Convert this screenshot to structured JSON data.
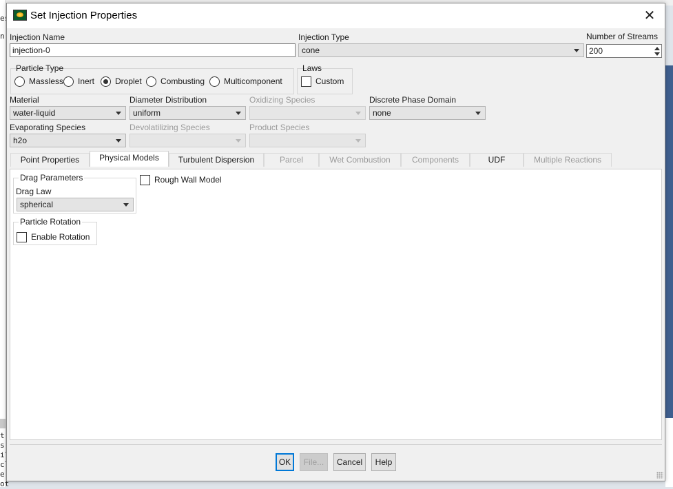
{
  "background": {
    "left_lines": [
      "es",
      "n",
      "t",
      "s",
      "il",
      "cl",
      "e",
      "ot"
    ]
  },
  "dialog": {
    "title": "Set Injection Properties",
    "close_glyph": "✕"
  },
  "injection_name": {
    "label": "Injection Name",
    "value": "injection-0"
  },
  "injection_type": {
    "label": "Injection Type",
    "value": "cone"
  },
  "number_of_streams": {
    "label": "Number of Streams",
    "value": "200"
  },
  "particle_type": {
    "label": "Particle Type",
    "options": [
      "Massless",
      "Inert",
      "Droplet",
      "Combusting",
      "Multicomponent"
    ],
    "selected": "Droplet"
  },
  "laws": {
    "label": "Laws",
    "custom_label": "Custom",
    "custom_checked": false
  },
  "material": {
    "label": "Material",
    "value": "water-liquid"
  },
  "diameter_distribution": {
    "label": "Diameter Distribution",
    "value": "uniform"
  },
  "oxidizing_species": {
    "label": "Oxidizing Species",
    "value": ""
  },
  "discrete_phase_domain": {
    "label": "Discrete Phase Domain",
    "value": "none"
  },
  "evaporating_species": {
    "label": "Evaporating Species",
    "value": "h2o"
  },
  "devolatilizing_species": {
    "label": "Devolatilizing Species",
    "value": ""
  },
  "product_species": {
    "label": "Product Species",
    "value": ""
  },
  "tabs": [
    {
      "label": "Point Properties",
      "active": false,
      "enabled": true
    },
    {
      "label": "Physical Models",
      "active": true,
      "enabled": true
    },
    {
      "label": "Turbulent Dispersion",
      "active": false,
      "enabled": true
    },
    {
      "label": "Parcel",
      "active": false,
      "enabled": false
    },
    {
      "label": "Wet Combustion",
      "active": false,
      "enabled": false
    },
    {
      "label": "Components",
      "active": false,
      "enabled": false
    },
    {
      "label": "UDF",
      "active": false,
      "enabled": true
    },
    {
      "label": "Multiple Reactions",
      "active": false,
      "enabled": false
    }
  ],
  "physical_models": {
    "drag_parameters": {
      "label": "Drag Parameters",
      "drag_law_label": "Drag Law",
      "drag_law_value": "spherical"
    },
    "rough_wall_model": {
      "label": "Rough Wall Model",
      "checked": false
    },
    "particle_rotation": {
      "label": "Particle Rotation",
      "enable_label": "Enable Rotation",
      "checked": false
    }
  },
  "buttons": {
    "ok": "OK",
    "file": "File...",
    "cancel": "Cancel",
    "help": "Help"
  },
  "colors": {
    "accent": "#0078d7",
    "dialog_bg": "#f0f0f0",
    "panel_bg": "#ffffff"
  }
}
